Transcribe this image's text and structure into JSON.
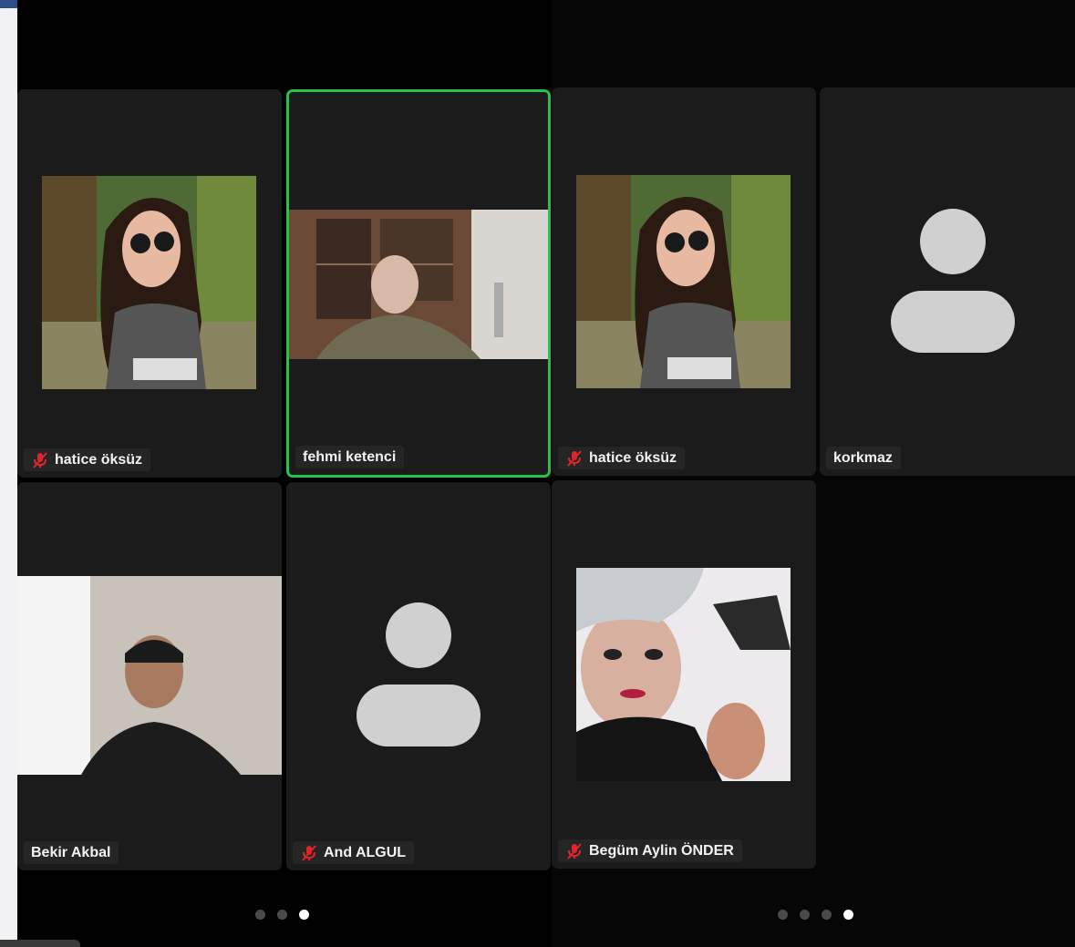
{
  "left_page": {
    "tiles": [
      {
        "name": "hatice öksüz",
        "muted": true
      },
      {
        "name": "fehmi ketenci",
        "muted": false,
        "speaking": true
      },
      {
        "name": "Bekir Akbal",
        "muted": false
      },
      {
        "name": "And ALGUL",
        "muted": true
      }
    ],
    "pager": {
      "total": 3,
      "current": 3
    }
  },
  "right_page": {
    "tiles": [
      {
        "name": "hatice öksüz",
        "muted": true
      },
      {
        "name": "korkmaz",
        "muted": false
      },
      {
        "name": "Begüm Aylin ÖNDER",
        "muted": true
      }
    ],
    "pager": {
      "total": 4,
      "current": 4
    }
  },
  "icons": {
    "muted_mic": "mic-off-icon",
    "placeholder": "user-avatar-icon"
  },
  "colors": {
    "active_speaker": "#26c24a",
    "muted": "#e0242b",
    "tile_bg": "#1b1b1b"
  }
}
